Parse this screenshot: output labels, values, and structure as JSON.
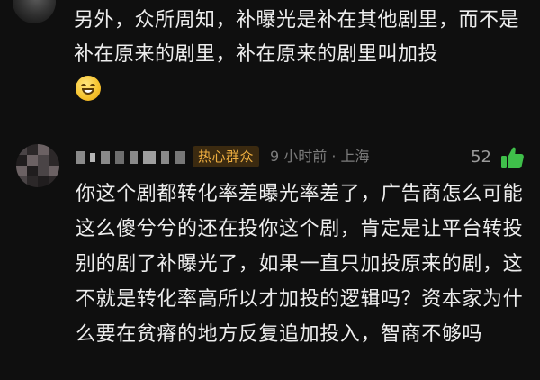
{
  "previous_comment": {
    "text": "另外，众所周知，补曝光是补在其他剧里，而不是补在原来的剧里，补在原来的剧里叫加投",
    "emoji": "grinning-face-emoji"
  },
  "comment": {
    "badge": "热心群众",
    "time": "9 小时前",
    "separator": "·",
    "location": "上海",
    "meta": "9 小时前 · 上海",
    "likes": "52",
    "text": "你这个剧都转化率差曝光率差了，广告商怎么可能这么傻兮兮的还在投你这个剧，肯定是让平台转投别的剧了补曝光了，如果一直只加投原来的剧，这不就是转化率高所以才加投的逻辑吗？资本家为什么要在贫瘠的地方反复追加投入，智商不够吗"
  },
  "colors": {
    "background": "#0f0f0f",
    "text": "#ededed",
    "meta": "#7c7c7c",
    "badge_text": "#f0b041",
    "badge_bg": "#3b2a10",
    "like_icon": "#3fbf4a"
  },
  "icons": {
    "like": "thumbs-up-icon"
  }
}
